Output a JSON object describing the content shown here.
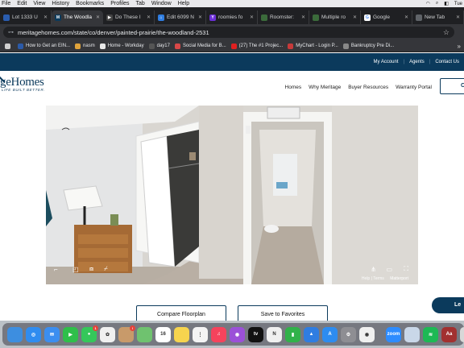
{
  "menubar": {
    "items": [
      "File",
      "Edit",
      "View",
      "History",
      "Bookmarks",
      "Profiles",
      "Tab",
      "Window",
      "Help"
    ],
    "clock": "Tue"
  },
  "tabs": [
    {
      "label": "Lot 1333 U",
      "color": "#2a5db0",
      "glyph": ""
    },
    {
      "label": "The Woodla",
      "color": "#0b3a5c",
      "glyph": "M",
      "active": true
    },
    {
      "label": "Do These I",
      "color": "#444",
      "glyph": "▶"
    },
    {
      "label": "Edit 6099 N",
      "color": "#2f7de1",
      "glyph": "⌂"
    },
    {
      "label": "roomies fo",
      "color": "#6b2fd6",
      "glyph": "Y"
    },
    {
      "label": "Roomster: ",
      "color": "#3b6b3b",
      "glyph": ""
    },
    {
      "label": "Multiple ro",
      "color": "#3b6b3b",
      "glyph": ""
    },
    {
      "label": "Google",
      "color": "#ffffff",
      "glyph": "G"
    },
    {
      "label": "New Tab",
      "color": "#5f6368",
      "glyph": ""
    }
  ],
  "address": {
    "url": "meritagehomes.com/state/co/denver/painted-prairie/the-woodland-2531"
  },
  "bookmarks": [
    {
      "label": "",
      "color": "#d0d0d0"
    },
    {
      "label": "How to Get an EIN...",
      "color": "#2b5aa8"
    },
    {
      "label": "nasm",
      "color": "#e0a33b"
    },
    {
      "label": "Home - Workday",
      "color": "#e8e8e8"
    },
    {
      "label": "day17",
      "color": "#555"
    },
    {
      "label": "Social Media for B...",
      "color": "#d94848"
    },
    {
      "label": "(27) The #1 Projec...",
      "color": "#e02020"
    },
    {
      "label": "MyChart - Login P...",
      "color": "#c73a3a"
    },
    {
      "label": "Bankruptcy Pre Di...",
      "color": "#888"
    }
  ],
  "site": {
    "topnav": [
      "My Account",
      "Agents",
      "Contact Us"
    ],
    "logo_text": "geHomes",
    "logo_tagline": "LIFE BUILT BETTER.",
    "mainnav": [
      "Homes",
      "Why Meritage",
      "Buyer Resources",
      "Warranty Portal"
    ],
    "cta_label": "C",
    "viewer_credit_help": "Help | Terms",
    "viewer_credit_brand": "Matterport",
    "compare_label": "Compare Floorplan",
    "favorite_label": "Save to Favorites",
    "chat_label": "Le"
  },
  "dock": [
    {
      "name": "finder-icon",
      "color": "#3d8ee0",
      "glyph": ""
    },
    {
      "name": "safari-icon",
      "color": "#2f8cf0",
      "glyph": "◎"
    },
    {
      "name": "mail-icon",
      "color": "#3b8ef0",
      "glyph": "✉"
    },
    {
      "name": "facetime-icon",
      "color": "#2fbf4a",
      "glyph": "▶"
    },
    {
      "name": "messages-icon",
      "color": "#35c75a",
      "glyph": "●",
      "badge": "1"
    },
    {
      "name": "photos-icon",
      "color": "#f0f0f0",
      "glyph": "✿"
    },
    {
      "name": "contacts-icon",
      "color": "#c89a6a",
      "glyph": "",
      "badge": "!"
    },
    {
      "name": "maps-icon",
      "color": "#6fc26f",
      "glyph": ""
    },
    {
      "name": "calendar-icon",
      "color": "#ffffff",
      "glyph": "16"
    },
    {
      "name": "notes-icon",
      "color": "#f6d44e",
      "glyph": ""
    },
    {
      "name": "reminders-icon",
      "color": "#f4f4f4",
      "glyph": "⋮"
    },
    {
      "name": "music-icon",
      "color": "#f5435c",
      "glyph": "♫"
    },
    {
      "name": "podcasts-icon",
      "color": "#9b50d8",
      "glyph": "◉"
    },
    {
      "name": "tv-icon",
      "color": "#111111",
      "glyph": "tv"
    },
    {
      "name": "news-icon",
      "color": "#f0f0f0",
      "glyph": "N"
    },
    {
      "name": "numbers-icon",
      "color": "#31b24a",
      "glyph": "▮"
    },
    {
      "name": "keynote-icon",
      "color": "#2f7de1",
      "glyph": "▲"
    },
    {
      "name": "appstore-icon",
      "color": "#2d8cf0",
      "glyph": "A"
    },
    {
      "name": "settings-icon",
      "color": "#8e8e93",
      "glyph": "⚙"
    },
    {
      "name": "chrome-icon",
      "color": "#f0f0f0",
      "glyph": "◉"
    },
    {
      "name": "zoom-icon",
      "color": "#2d8cff",
      "glyph": "zoom"
    },
    {
      "name": "preview-icon",
      "color": "#c9d7e8",
      "glyph": ""
    },
    {
      "name": "spotify-icon",
      "color": "#1db954",
      "glyph": "≋"
    },
    {
      "name": "dictionary-icon",
      "color": "#a23030",
      "glyph": "Aa"
    },
    {
      "name": "trash-icon",
      "color": "#d8d8d8",
      "glyph": ""
    }
  ]
}
